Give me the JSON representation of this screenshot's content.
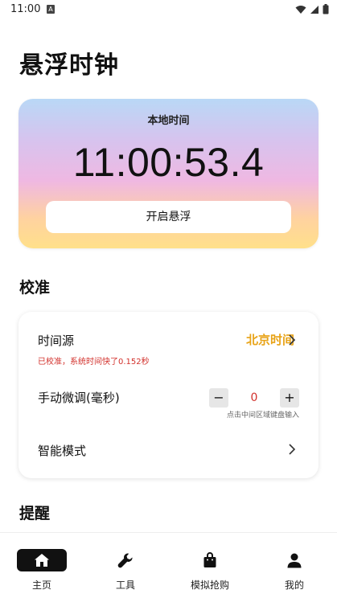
{
  "status_bar": {
    "time": "11:00",
    "badge": "A"
  },
  "page_title": "悬浮时钟",
  "clock": {
    "label": "本地时间",
    "time": "11:00:53.4",
    "float_button_label": "开启悬浮"
  },
  "calibration": {
    "title": "校准",
    "time_source_label": "时间源",
    "time_source_value": "北京时间",
    "status_note": "已校准，系统时间快了0.152秒",
    "manual_adjust_label": "手动微调(毫秒)",
    "minus_label": "−",
    "adjust_value": "0",
    "plus_label": "+",
    "stepper_hint": "点击中间区域键盘输入",
    "smart_mode_label": "智能模式"
  },
  "reminder": {
    "title": "提醒"
  },
  "nav": {
    "items": [
      {
        "label": "主页",
        "icon": "home-icon",
        "active": true
      },
      {
        "label": "工具",
        "icon": "wrench-icon",
        "active": false
      },
      {
        "label": "模拟抢购",
        "icon": "shopping-bag-icon",
        "active": false
      },
      {
        "label": "我的",
        "icon": "person-icon",
        "active": false
      }
    ]
  },
  "colors": {
    "accent_orange": "#e8a317",
    "note_red": "#d2302b",
    "active_tab": "#111111"
  }
}
